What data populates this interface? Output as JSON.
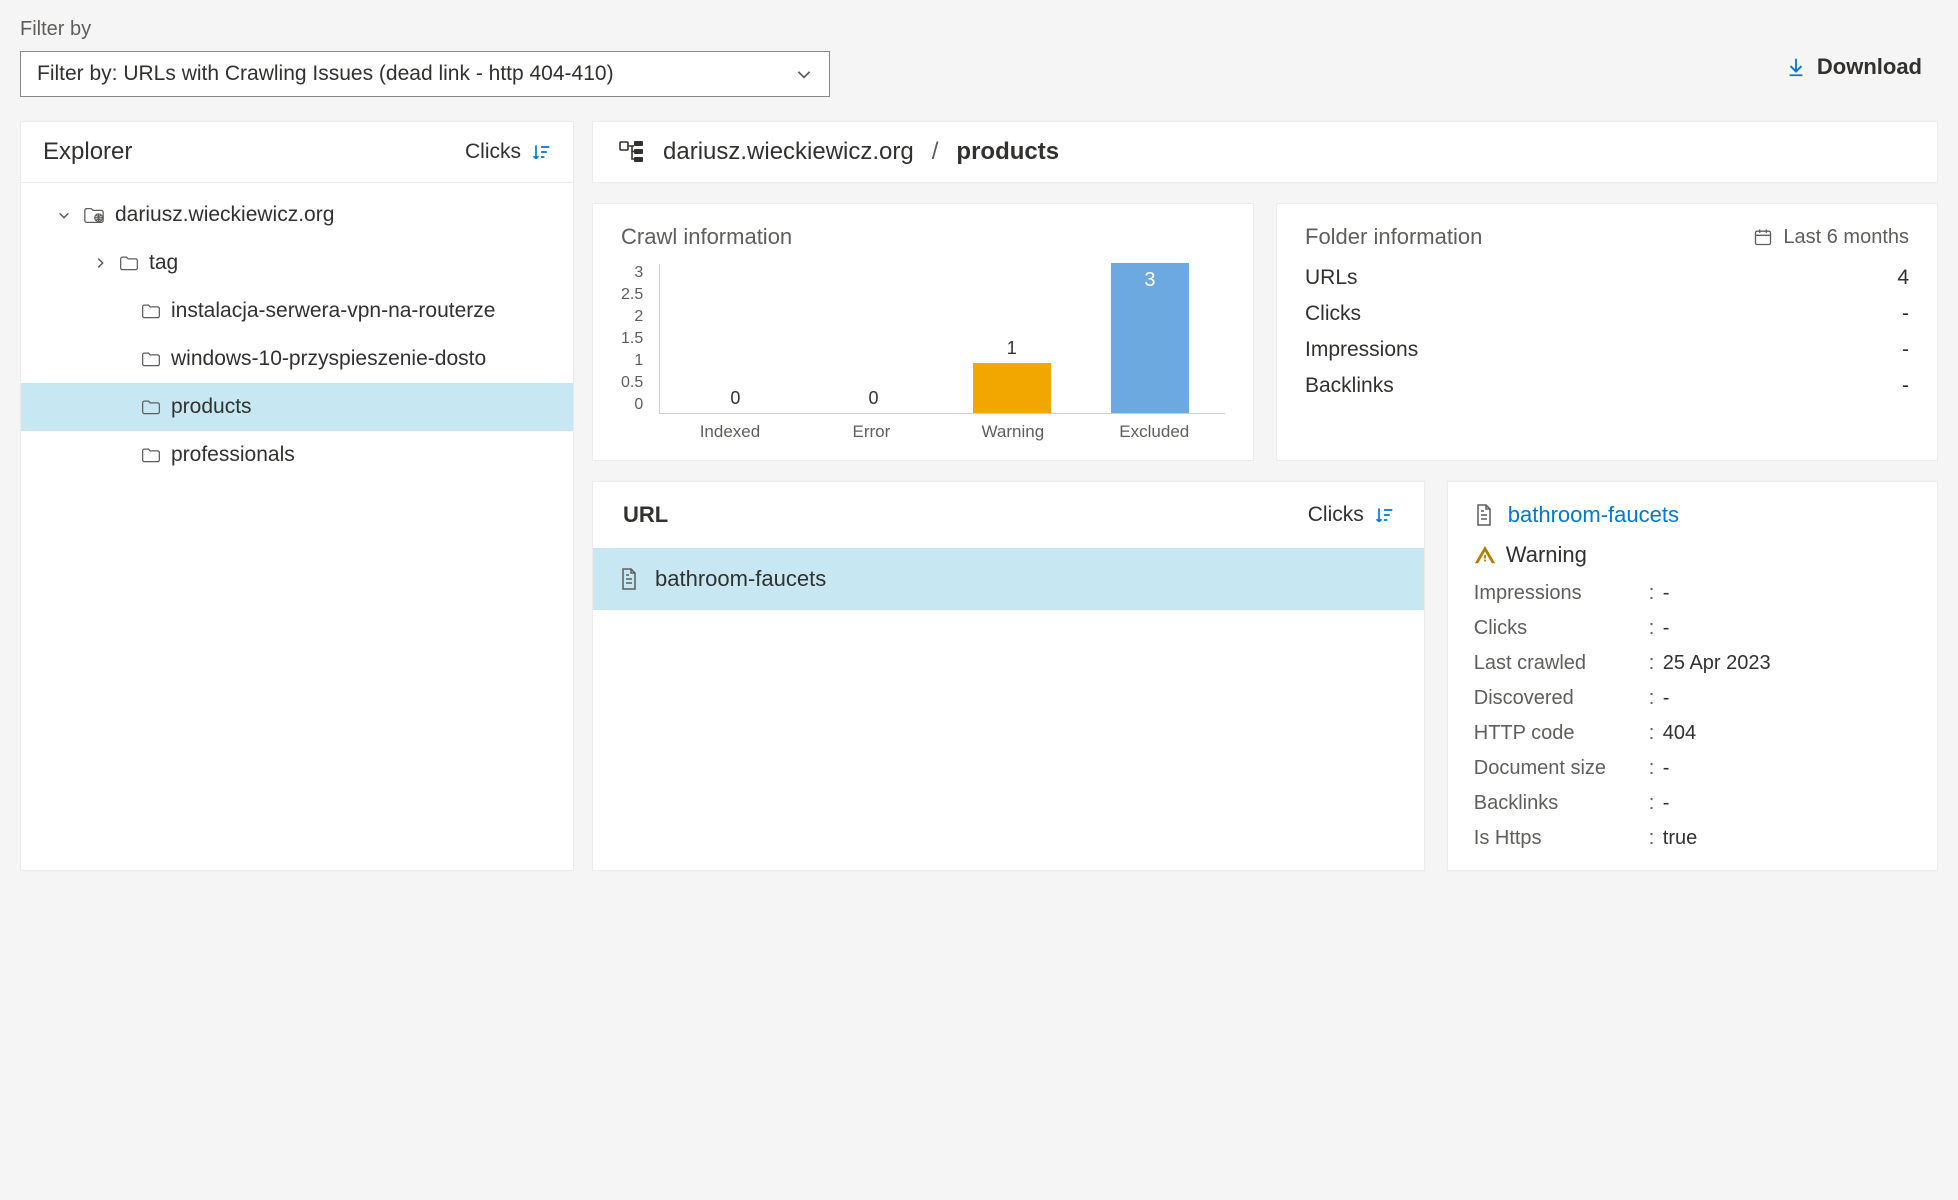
{
  "filter": {
    "label": "Filter by",
    "selected": "Filter by: URLs with Crawling Issues (dead link - http 404-410)"
  },
  "download_label": "Download",
  "explorer": {
    "title": "Explorer",
    "sort_label": "Clicks",
    "tree": {
      "root": "dariusz.wieckiewicz.org",
      "tag": "tag",
      "instalacja": "instalacja-serwera-vpn-na-routerze",
      "windows": "windows-10-przyspieszenie-dosto",
      "products": "products",
      "professionals": "professionals"
    }
  },
  "breadcrumb": {
    "site": "dariusz.wieckiewicz.org",
    "sep": "/",
    "current": "products"
  },
  "crawl": {
    "title": "Crawl information",
    "y_ticks": [
      "3",
      "2.5",
      "2",
      "1.5",
      "1",
      "0.5",
      "0"
    ],
    "categories": [
      "Indexed",
      "Error",
      "Warning",
      "Excluded"
    ],
    "labels": {
      "indexed": "0",
      "error": "0",
      "warning": "1",
      "excluded": "3"
    }
  },
  "folder": {
    "title": "Folder information",
    "period": "Last 6 months",
    "rows": {
      "urls_k": "URLs",
      "urls_v": "4",
      "clicks_k": "Clicks",
      "clicks_v": "-",
      "impr_k": "Impressions",
      "impr_v": "-",
      "back_k": "Backlinks",
      "back_v": "-"
    }
  },
  "url_panel": {
    "header": "URL",
    "sort_label": "Clicks",
    "row0": "bathroom-faucets"
  },
  "detail": {
    "title": "bathroom-faucets",
    "status": "Warning",
    "rows": {
      "impr_k": "Impressions",
      "impr_v": "-",
      "clicks_k": "Clicks",
      "clicks_v": "-",
      "lastcrawl_k": "Last crawled",
      "lastcrawl_v": "25 Apr 2023",
      "discovered_k": "Discovered",
      "discovered_v": "-",
      "http_k": "HTTP code",
      "http_v": "404",
      "docsize_k": "Document size",
      "docsize_v": "-",
      "back_k": "Backlinks",
      "back_v": "-",
      "https_k": "Is Https",
      "https_v": "true"
    }
  },
  "chart_data": {
    "type": "bar",
    "title": "Crawl information",
    "categories": [
      "Indexed",
      "Error",
      "Warning",
      "Excluded"
    ],
    "values": [
      0,
      0,
      1,
      3
    ],
    "ylim": [
      0,
      3
    ],
    "xlabel": "",
    "ylabel": ""
  }
}
